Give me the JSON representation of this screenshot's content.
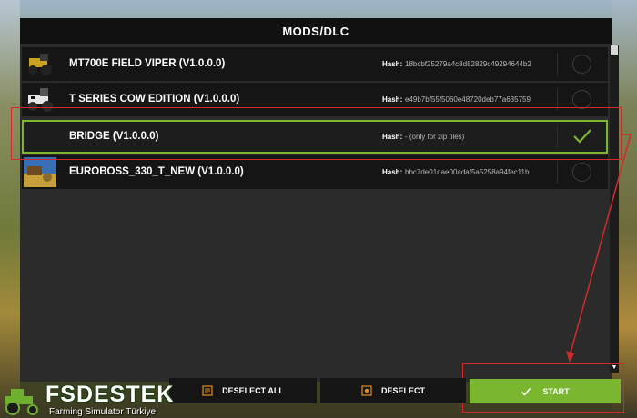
{
  "header": {
    "title": "MODS/DLC"
  },
  "mods": [
    {
      "name": "MT700E FIELD VIPER (V1.0.0.0)",
      "hash_label": "Hash:",
      "hash": "18bcbf25279a4c8d82829c49294644b2",
      "selected": false,
      "thumb": "tractor-thumbnail"
    },
    {
      "name": "T SERIES COW EDITION (V1.0.0.0)",
      "hash_label": "Hash:",
      "hash": "e49b7bf55f5060e48720deb77a635759",
      "selected": false,
      "thumb": "tractor-thumbnail"
    },
    {
      "name": "BRIDGE (V1.0.0.0)",
      "hash_label": "Hash:",
      "hash": "- (only for zip files)",
      "selected": true,
      "thumb": "empty"
    },
    {
      "name": "EUROBOSS_330_T_NEW (V1.0.0.0)",
      "hash_label": "Hash:",
      "hash": "bbc7de01dae00adaf5a5258a94fec11b",
      "selected": false,
      "thumb": "hay-thumbnail"
    }
  ],
  "footer": {
    "deselect_all_label": "DESELECT ALL",
    "deselect_label": "DESELECT",
    "start_label": "START"
  },
  "watermark": {
    "title": "FSDESTEK",
    "subtitle": "Farming Simulator Türkiye"
  },
  "colors": {
    "accent": "#7ab62f",
    "annotation": "#d32b2b",
    "panel": "#2b2b2b",
    "row": "#151515"
  }
}
